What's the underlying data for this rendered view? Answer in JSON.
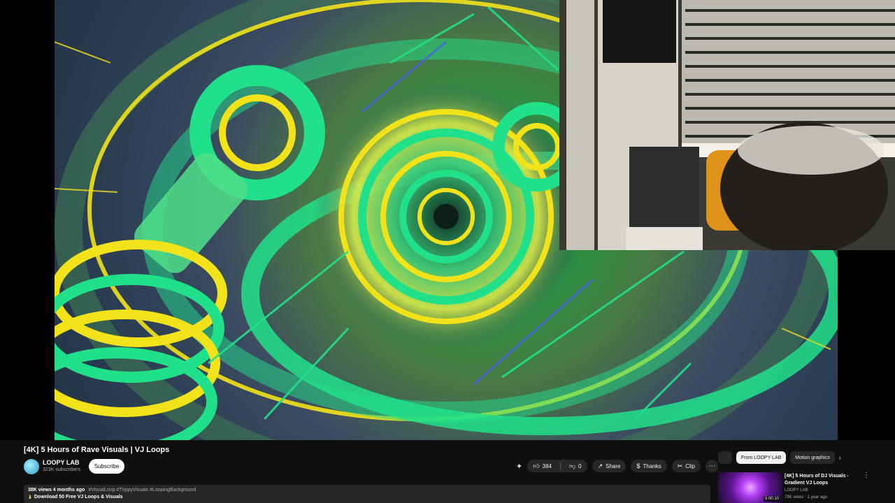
{
  "video": {
    "title": "[4K] 5 Hours of Rave Visuals | VJ Loops",
    "channel_name": "LOOPY LAB",
    "subscribers": "323K subscribers",
    "subscribe_label": "Subscribe"
  },
  "actions": {
    "like_count": "384",
    "dislike_label": "0",
    "share_label": "Share",
    "thanks_label": "Thanks",
    "clip_label": "Clip"
  },
  "description": {
    "stats": "38K views  4 months ago",
    "tags": "#VisualLoop #TrippyVisuals #LoopingBackground",
    "download_text": "Download 50 Free VJ Loops & Visuals"
  },
  "rail": {
    "chips": [
      "From LOOPY LAB",
      "Motion graphics"
    ],
    "rec": {
      "title": "[4K] 5 Hours of DJ Visuals - Gradient VJ Loops",
      "channel": "LOOPY LAB",
      "meta": "78K views · 1 year ago",
      "duration": "5:00:10"
    }
  },
  "colors": {
    "accent_yellow": "#f2e21a",
    "accent_green": "#21e08a",
    "background": "#0f0f0f"
  }
}
